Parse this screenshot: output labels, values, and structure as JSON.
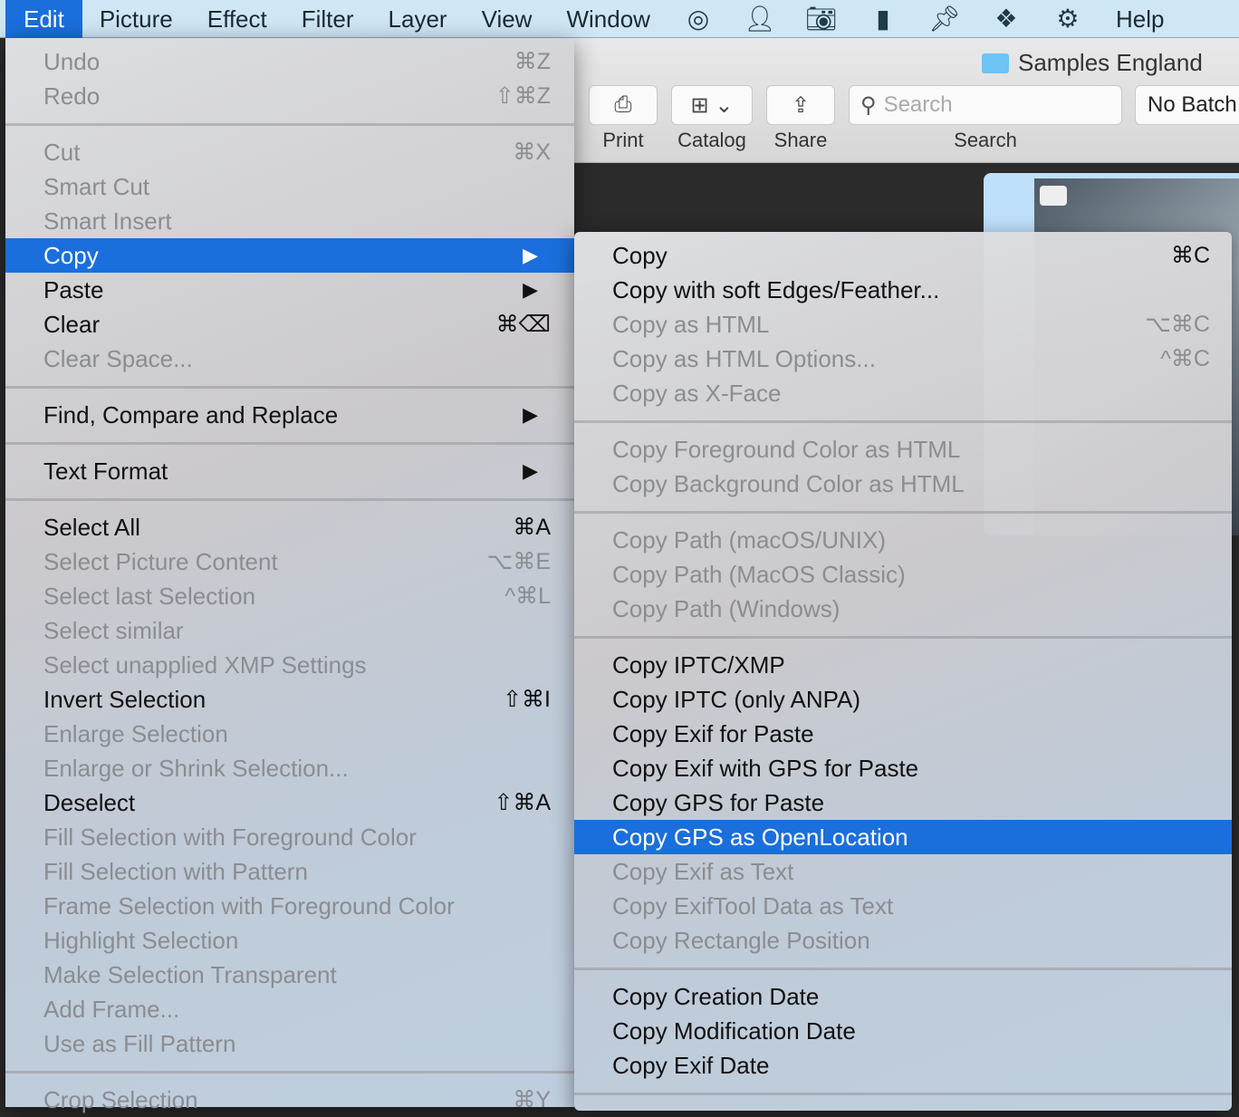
{
  "menubar": {
    "items": [
      "Edit",
      "Picture",
      "Effect",
      "Filter",
      "Layer",
      "View",
      "Window"
    ],
    "icons": [
      "target-icon",
      "person-icon",
      "camera-icon",
      "clipboard-icon",
      "pin-icon",
      "scroll-icon",
      "gear-icon"
    ],
    "help": "Help",
    "active": "Edit"
  },
  "window": {
    "folder": "Samples England",
    "toolbar": {
      "print": "Print",
      "catalog": "Catalog",
      "share": "Share",
      "search_placeholder": "Search",
      "search_label": "Search",
      "batch": "No Batch"
    }
  },
  "edit_menu": [
    {
      "label": "Undo",
      "shortcut": "⌘Z",
      "disabled": true
    },
    {
      "label": "Redo",
      "shortcut": "⇧⌘Z",
      "disabled": true
    },
    {
      "sep": true
    },
    {
      "label": "Cut",
      "shortcut": "⌘X",
      "disabled": true
    },
    {
      "label": "Smart Cut",
      "disabled": true
    },
    {
      "label": "Smart Insert",
      "disabled": true
    },
    {
      "label": "Copy",
      "submenu": true,
      "highlighted": true
    },
    {
      "label": "Paste",
      "submenu": true
    },
    {
      "label": "Clear",
      "shortcut": "⌘⌫"
    },
    {
      "label": "Clear Space...",
      "disabled": true
    },
    {
      "sep": true
    },
    {
      "label": "Find, Compare and Replace",
      "submenu": true
    },
    {
      "sep": true
    },
    {
      "label": "Text Format",
      "submenu": true
    },
    {
      "sep": true
    },
    {
      "label": "Select All",
      "shortcut": "⌘A"
    },
    {
      "label": "Select Picture Content",
      "shortcut": "⌥⌘E",
      "disabled": true
    },
    {
      "label": "Select last Selection",
      "shortcut": "^⌘L",
      "disabled": true
    },
    {
      "label": "Select similar",
      "disabled": true
    },
    {
      "label": "Select unapplied XMP Settings",
      "disabled": true
    },
    {
      "label": "Invert Selection",
      "shortcut": "⇧⌘I"
    },
    {
      "label": "Enlarge Selection",
      "disabled": true
    },
    {
      "label": "Enlarge or Shrink Selection...",
      "disabled": true
    },
    {
      "label": "Deselect",
      "shortcut": "⇧⌘A"
    },
    {
      "label": "Fill Selection with Foreground Color",
      "disabled": true
    },
    {
      "label": "Fill Selection with Pattern",
      "disabled": true
    },
    {
      "label": "Frame Selection with Foreground Color",
      "disabled": true
    },
    {
      "label": "Highlight Selection",
      "disabled": true
    },
    {
      "label": "Make Selection Transparent",
      "disabled": true
    },
    {
      "label": "Add Frame...",
      "disabled": true
    },
    {
      "label": "Use as Fill Pattern",
      "disabled": true
    },
    {
      "sep": true
    },
    {
      "label": "Crop Selection",
      "shortcut": "⌘Y",
      "disabled": true
    }
  ],
  "copy_submenu": [
    {
      "label": "Copy",
      "shortcut": "⌘C"
    },
    {
      "label": "Copy with soft Edges/Feather..."
    },
    {
      "label": "Copy as HTML",
      "shortcut": "⌥⌘C",
      "disabled": true
    },
    {
      "label": "Copy as HTML Options...",
      "shortcut": "^⌘C",
      "disabled": true
    },
    {
      "label": "Copy as X-Face",
      "disabled": true
    },
    {
      "sep": true
    },
    {
      "label": "Copy Foreground Color as HTML",
      "disabled": true
    },
    {
      "label": "Copy Background Color as HTML",
      "disabled": true
    },
    {
      "sep": true
    },
    {
      "label": "Copy Path (macOS/UNIX)",
      "disabled": true
    },
    {
      "label": "Copy Path (MacOS Classic)",
      "disabled": true
    },
    {
      "label": "Copy Path (Windows)",
      "disabled": true
    },
    {
      "sep": true
    },
    {
      "label": "Copy IPTC/XMP"
    },
    {
      "label": "Copy IPTC (only ANPA)"
    },
    {
      "label": "Copy Exif for Paste"
    },
    {
      "label": "Copy Exif with GPS for Paste"
    },
    {
      "label": "Copy GPS for Paste"
    },
    {
      "label": "Copy GPS as OpenLocation",
      "highlighted": true
    },
    {
      "label": "Copy Exif as Text",
      "disabled": true
    },
    {
      "label": "Copy ExifTool Data as Text",
      "disabled": true
    },
    {
      "label": "Copy Rectangle Position",
      "disabled": true
    },
    {
      "sep": true
    },
    {
      "label": "Copy Creation Date"
    },
    {
      "label": "Copy Modification Date"
    },
    {
      "label": "Copy Exif Date"
    },
    {
      "sep": true
    }
  ],
  "colors": {
    "highlight": "#1a6fdc",
    "menubar": "#cfe6f4"
  }
}
